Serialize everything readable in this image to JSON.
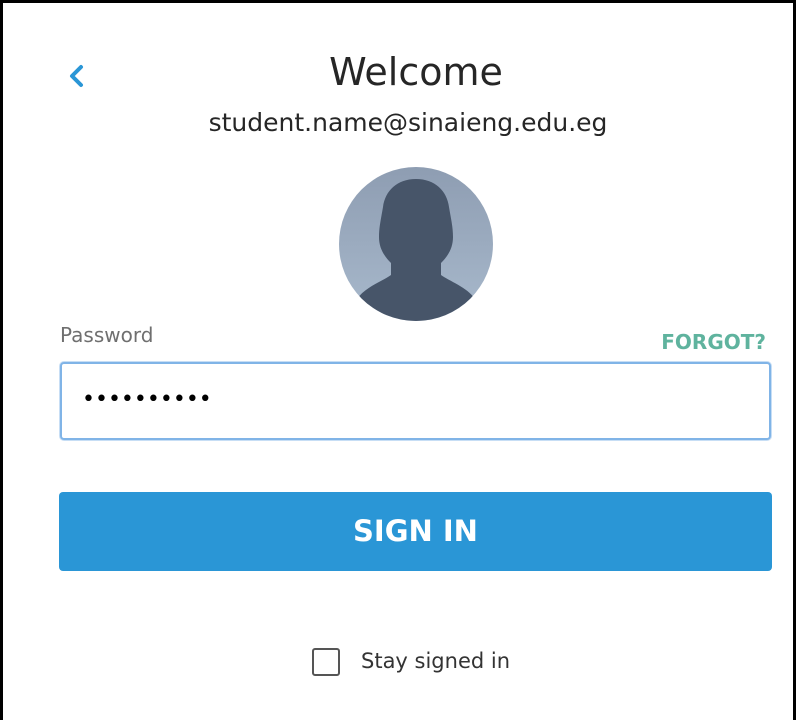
{
  "header": {
    "title": "Welcome",
    "email": "student.name@sinaieng.edu.eg"
  },
  "icons": {
    "back": "chevron-left-icon",
    "avatar": "person-silhouette-icon"
  },
  "password": {
    "label": "Password",
    "forgot_label": "FORGOT?",
    "masked_value": "••••••••••"
  },
  "sign_in": {
    "label": "SIGN IN"
  },
  "stay_signed_in": {
    "label": "Stay signed in",
    "checked": false
  },
  "colors": {
    "accent": "#2a96d6",
    "link": "#5fb39e",
    "input_focus": "#80b4e7",
    "avatar_bg": "#a1b1c5",
    "silhouette": "#475569"
  }
}
